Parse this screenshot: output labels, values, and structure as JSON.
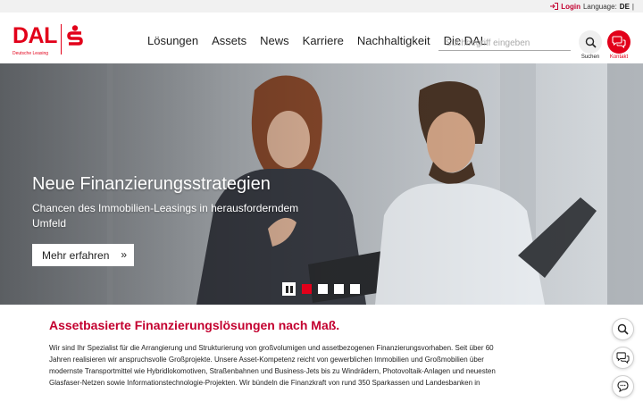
{
  "topbar": {
    "login_label": "Login",
    "language_label": "Language:",
    "language_value": "DE",
    "separator": "|"
  },
  "logo": {
    "brand": "DAL",
    "subtitle": "Deutsche Leasing"
  },
  "nav": {
    "items": [
      "Lösungen",
      "Assets",
      "News",
      "Karriere",
      "Nachhaltigkeit",
      "Die DAL"
    ]
  },
  "search": {
    "placeholder": "Suchbegriff eingeben",
    "button_label": "Suchen"
  },
  "kontakt": {
    "button_label": "Kontakt"
  },
  "hero": {
    "title": "Neue Finanzierungsstrategien",
    "subtitle": "Chancen des Immobilien-Leasings in herausforderndem Umfeld",
    "cta_label": "Mehr erfahren",
    "cta_chevron": "»",
    "slides_total": 4,
    "active_slide": 1
  },
  "content": {
    "title": "Assetbasierte Finanzierungslösungen nach Maß.",
    "body": "Wir sind Ihr Spezialist für die Arrangierung und Strukturierung von großvolumigen und assetbezogenen Finanzierungsvorhaben. Seit über 60 Jahren realisieren wir anspruchsvolle Großprojekte. Unsere Asset-Kompetenz reicht von gewerblichen Immobilien und Großmobilien über modernste Transportmittel wie Hybridlokomotiven, Straßenbahnen und Business-Jets bis zu Windrädern, Photovoltaik-Anlagen und neuesten Glasfaser-Netzen sowie Informationstechnologie-Projekten. Wir bündeln die Finanzkraft von rund 350 Sparkassen und Landesbanken in"
  },
  "colors": {
    "brand_red": "#e2001a",
    "heading_red": "#c3002f",
    "topbar_bg": "#f1f1f1"
  },
  "icons": {
    "login": "login-arrow-icon",
    "search": "magnifier-icon",
    "kontakt": "chat-bubbles-icon",
    "side": [
      "magnifier-icon",
      "chat-bubbles-icon",
      "chat-bubble-icon"
    ]
  }
}
